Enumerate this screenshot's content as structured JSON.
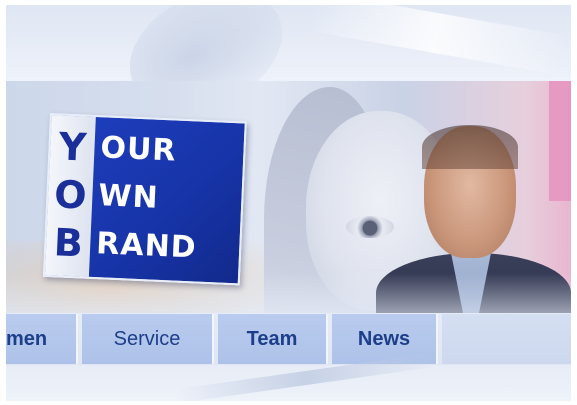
{
  "brand": {
    "initials": [
      "Y",
      "O",
      "B"
    ],
    "words": [
      "OUR",
      "WN",
      "RAND"
    ],
    "background_color": "#1f3fc0"
  },
  "nav": {
    "items": [
      {
        "label": "men"
      },
      {
        "label": "Service"
      },
      {
        "label": "Team"
      },
      {
        "label": "News"
      },
      {
        "label": ""
      }
    ],
    "text_color": "#1d3f8a",
    "tab_color": "#b9cbee"
  }
}
